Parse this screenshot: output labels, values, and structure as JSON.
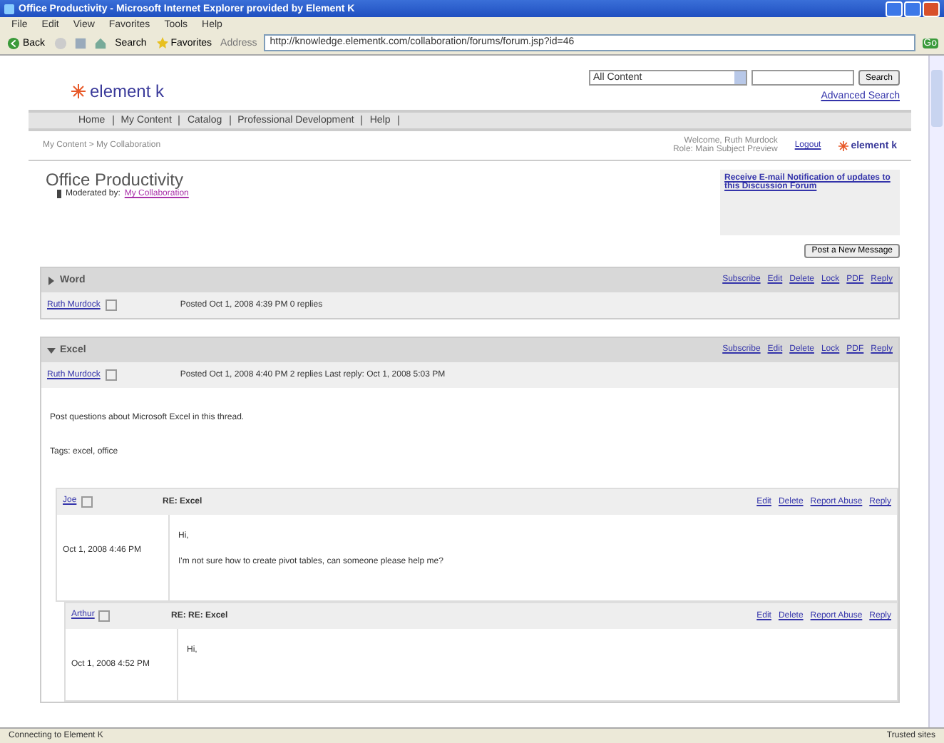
{
  "window": {
    "title": "Office Productivity - Microsoft Internet Explorer provided by Element K"
  },
  "menu": [
    "File",
    "Edit",
    "View",
    "Favorites",
    "Tools",
    "Help"
  ],
  "toolbar": {
    "back": "Back",
    "search": "Search",
    "favorites": "Favorites",
    "address_label": "Address",
    "url": "http://knowledge.elementk.com/collaboration/forums/forum.jsp?id=46",
    "go": "Go"
  },
  "header": {
    "logo": "element k",
    "scope": "All Content",
    "search_button": "Search",
    "advanced": "Advanced Search"
  },
  "nav": [
    "Home",
    "My Content",
    "Catalog",
    "Professional Development",
    "Help"
  ],
  "subheader": {
    "breadcrumb": "My Content > My Collaboration",
    "welcome": "Welcome, Ruth Murdock",
    "role": "Role: Main Subject Preview",
    "logout": "Logout",
    "logo": "element k"
  },
  "forum": {
    "title": "Office Productivity",
    "moderated_label": "Moderated by:",
    "moderator": "My Collaboration",
    "notify": "Receive E-mail Notification of updates to this Discussion Forum",
    "new_button": "Post a New Message"
  },
  "threads": [
    {
      "title": "Word",
      "expanded": false,
      "actions": [
        "Subscribe",
        "Edit",
        "Delete",
        "Lock",
        "PDF",
        "Reply"
      ],
      "author": "Ruth Murdock",
      "meta": "Posted Oct 1, 2008 4:39 PM   0 replies"
    },
    {
      "title": "Excel",
      "expanded": true,
      "actions": [
        "Subscribe",
        "Edit",
        "Delete",
        "Lock",
        "PDF",
        "Reply"
      ],
      "author": "Ruth Murdock",
      "meta": "Posted Oct 1, 2008 4:40 PM   2 replies   Last reply: Oct 1, 2008 5:03 PM",
      "body": [
        "Post questions about Microsoft Excel in this thread.",
        "Tags: excel, office"
      ],
      "replies": [
        {
          "author": "Joe",
          "subject": "RE: Excel",
          "actions": [
            "Edit",
            "Delete",
            "Report Abuse",
            "Reply"
          ],
          "date": "Oct 1, 2008 4:46 PM",
          "body": [
            "Hi,",
            "I'm not sure how to create pivot tables, can someone please help me?"
          ]
        },
        {
          "author": "Arthur",
          "subject": "RE: RE: Excel",
          "actions": [
            "Edit",
            "Delete",
            "Report Abuse",
            "Reply"
          ],
          "date": "Oct 1, 2008 4:52 PM",
          "body": [
            "Hi,"
          ]
        }
      ]
    }
  ],
  "status_bar": {
    "text": "Connecting to Element K",
    "zone": "Trusted sites"
  }
}
